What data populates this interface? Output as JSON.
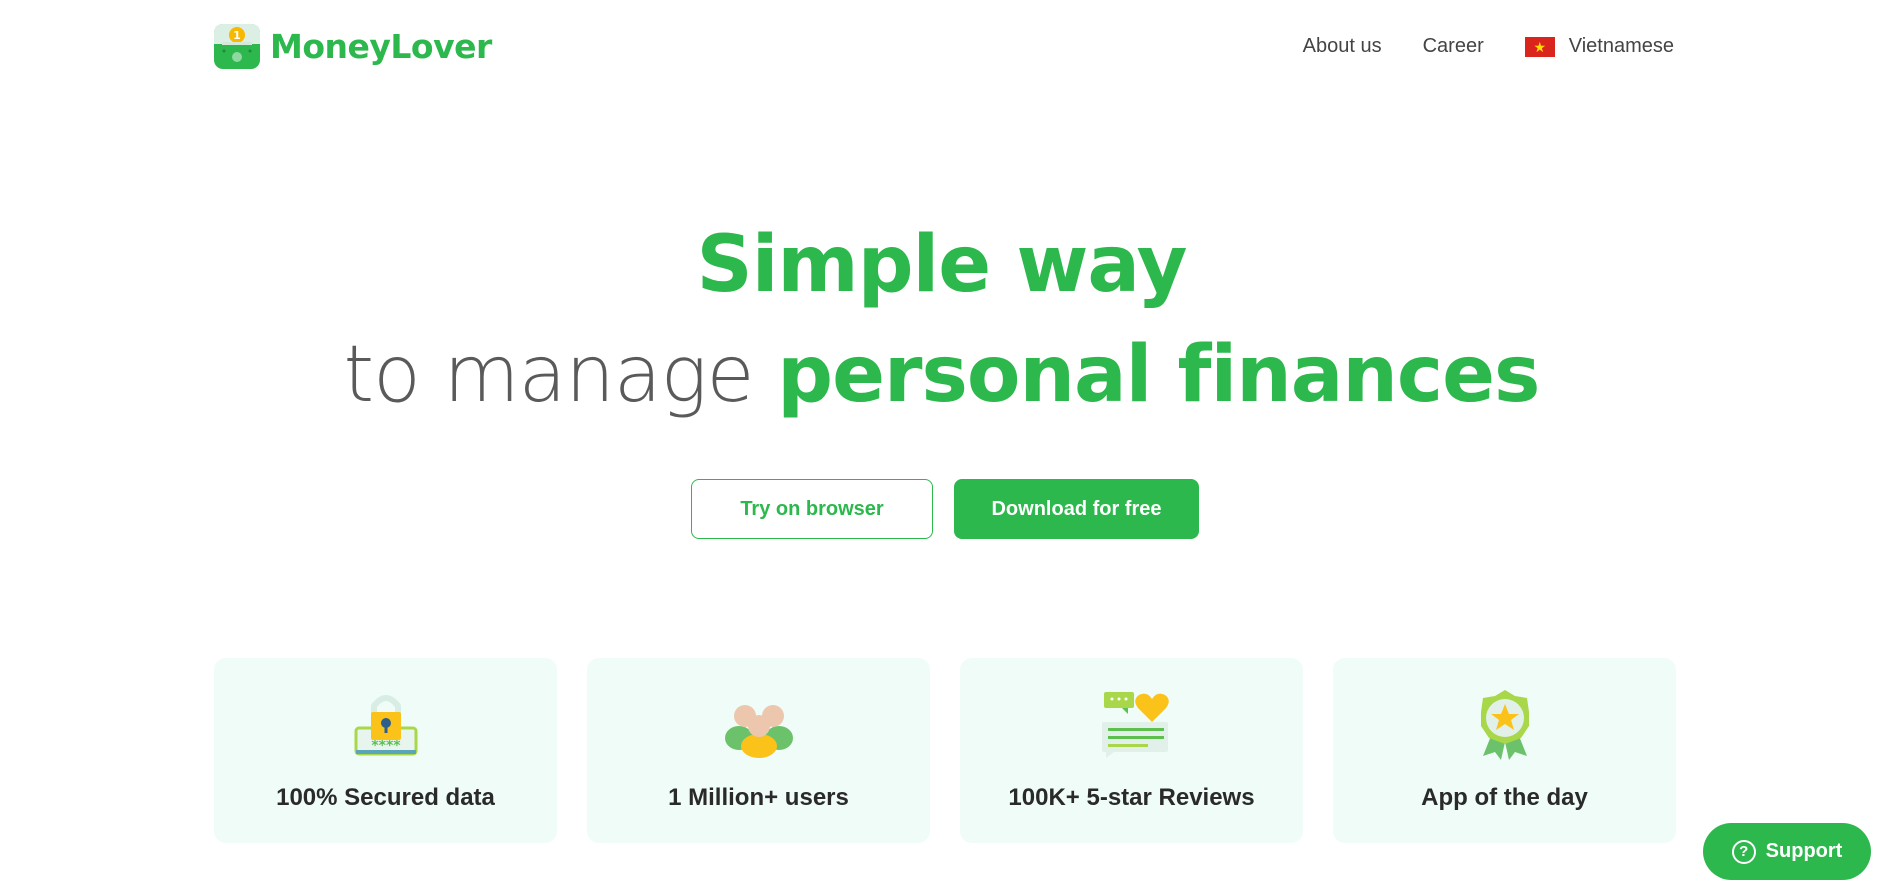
{
  "brand": {
    "name": "MoneyLover",
    "accent_color": "#2db84d"
  },
  "nav": {
    "items": [
      {
        "label": "About us"
      },
      {
        "label": "Career"
      }
    ],
    "language": {
      "label": "Vietnamese",
      "flag_icon": "vietnam-flag-icon"
    }
  },
  "hero": {
    "line1": "Simple way",
    "line2_light": "to manage",
    "line2_bold": "personal finances"
  },
  "ctas": {
    "try_label": "Try on browser",
    "download_label": "Download for free"
  },
  "features": [
    {
      "icon": "padlock-password-icon",
      "label": "100% Secured data"
    },
    {
      "icon": "users-group-icon",
      "label": "1 Million+ users"
    },
    {
      "icon": "reviews-heart-icon",
      "label": "100K+ 5-star Reviews"
    },
    {
      "icon": "award-badge-icon",
      "label": "App of the day"
    }
  ],
  "support": {
    "label": "Support",
    "icon": "question-circle-icon"
  }
}
